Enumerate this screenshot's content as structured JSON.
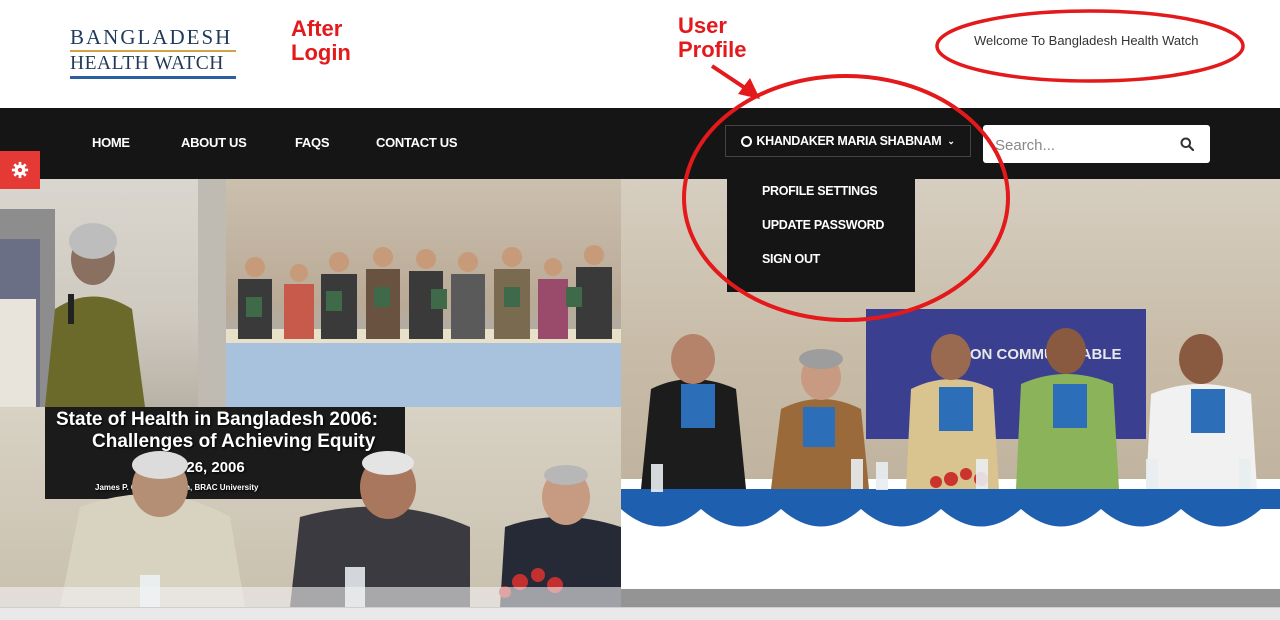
{
  "logo": {
    "line1": "BANGLADESH",
    "line2": "HEALTH WATCH"
  },
  "welcome_text": "Welcome To Bangladesh Health Watch",
  "annotations": {
    "after_login": [
      "After",
      "Login"
    ],
    "user_profile": [
      "User",
      "Profile"
    ],
    "color": "#e3191b"
  },
  "nav": {
    "items": [
      "HOME",
      "ABOUT US",
      "FAQS",
      "CONTACT US"
    ],
    "user_name": "KHANDAKER MARIA SHABNAM",
    "search_placeholder": "Search..."
  },
  "dropdown": {
    "items": [
      "PROFILE SETTINGS",
      "UPDATE PASSWORD",
      "SIGN OUT"
    ]
  },
  "hero": {
    "banner_line1": "State of Health in Bangladesh 2006:",
    "banner_line2": "Challenges of Achieving Equity",
    "banner_line3": "er 26, 2006",
    "banner_line4": "James P. G     Public Health, BRAC University",
    "backdrop_text": "NON COMMUNICABLE"
  },
  "colors": {
    "nav_bg": "#151515",
    "gear_bg": "#e53935",
    "logo_gold": "#d0a24a",
    "logo_blue": "#2c5fa0"
  }
}
